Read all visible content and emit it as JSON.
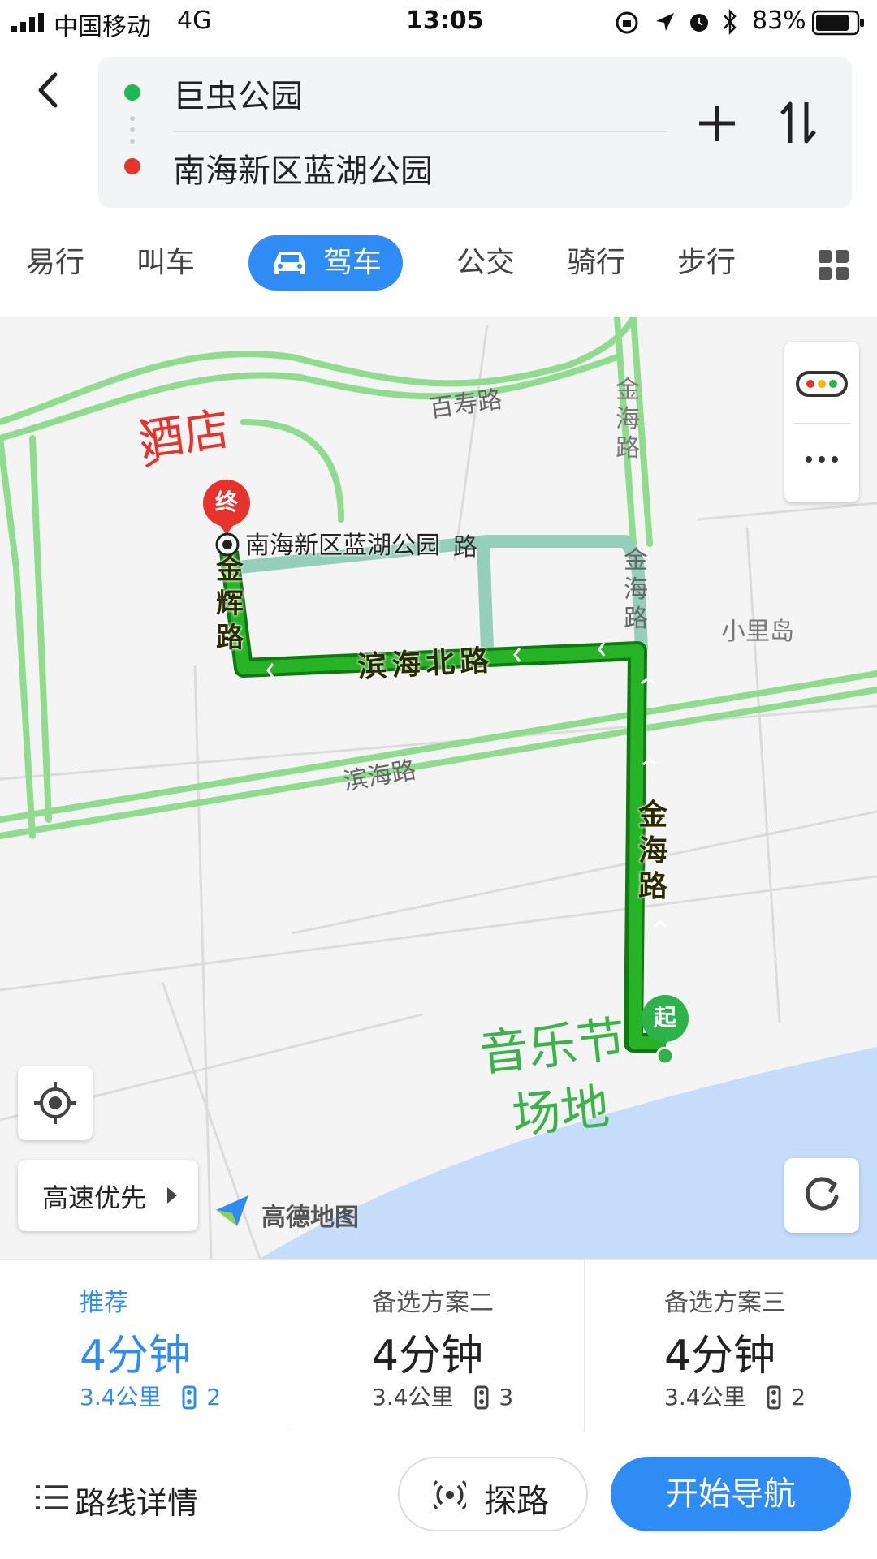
{
  "status_bar": {
    "carrier": "中国移动",
    "network": "4G",
    "time": "13:05",
    "battery": "83%"
  },
  "route": {
    "origin": "巨虫公园",
    "destination": "南海新区蓝湖公园",
    "origin_color": "#1db954",
    "destination_color": "#e8332d"
  },
  "modes": [
    {
      "label": "易行"
    },
    {
      "label": "叫车"
    },
    {
      "label": "驾车",
      "active": true
    },
    {
      "label": "公交"
    },
    {
      "label": "骑行"
    },
    {
      "label": "步行"
    }
  ],
  "map": {
    "road_labels": {
      "baishou": "百寿路",
      "jinhai_top": "金海路",
      "jinhai_mid": "金海路",
      "binhai_north": "滨海北路",
      "binhai": "滨海路",
      "jinhai_route": "金海路",
      "jinhui": "金辉路",
      "xiaoli_island": "小里岛",
      "road_suffix": "路"
    },
    "end_marker": "终",
    "start_marker": "起",
    "end_label": "南海新区蓝湖公园",
    "handwritten_hotel": "酒店",
    "handwritten_music_1": "音乐节",
    "handwritten_music_2": "场地",
    "preference": "高速优先",
    "logo_text": "高德地图",
    "accent_route": "#1ea31e",
    "accent_water": "#c5ddfb"
  },
  "plans": [
    {
      "name": "推荐",
      "time": "4分钟",
      "distance": "3.4公里",
      "lights": "2",
      "active": true
    },
    {
      "name": "备选方案二",
      "time": "4分钟",
      "distance": "3.4公里",
      "lights": "3"
    },
    {
      "name": "备选方案三",
      "time": "4分钟",
      "distance": "3.4公里",
      "lights": "2"
    }
  ],
  "actions": {
    "details": "路线详情",
    "explore": "探路",
    "navigate": "开始导航"
  },
  "icons": [
    "back-icon",
    "add-icon",
    "swap-icon",
    "grid-icon",
    "car-icon",
    "traffic-icon",
    "more-icon",
    "locate-icon",
    "refresh-icon",
    "list-icon",
    "radar-icon",
    "traffic-light-icon"
  ]
}
